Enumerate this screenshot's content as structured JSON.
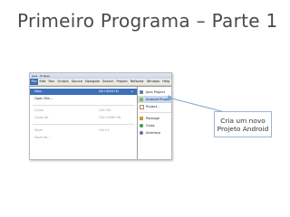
{
  "slide": {
    "title": "Primeiro Programa – Parte 1"
  },
  "window": {
    "title": "Java - Eclipse",
    "menubar": [
      "File",
      "Edit",
      "Run",
      "Scripts",
      "Source",
      "Navigate",
      "Search",
      "Project",
      "Refactor",
      "Window",
      "Help"
    ]
  },
  "file_menu": {
    "items": [
      {
        "label": "New",
        "accel": "Alt+Shift+N",
        "arrow": "▸",
        "highlighted": true
      },
      {
        "label": "Open File...",
        "accel": ""
      },
      {
        "label": "Close",
        "accel": "Ctrl+W",
        "disabled": true
      },
      {
        "label": "Close All",
        "accel": "Ctrl+Shift+W",
        "disabled": true
      },
      {
        "label": "Save",
        "accel": "Ctrl+S",
        "disabled": true
      },
      {
        "label": "Save As...",
        "accel": "",
        "disabled": true
      }
    ]
  },
  "submenu": {
    "items": [
      {
        "label": "Java Project",
        "icon": "java-project-icon",
        "color": "#5b7fb5"
      },
      {
        "label": "Android Project",
        "icon": "android-project-icon",
        "color": "#8ab833",
        "highlighted": true
      },
      {
        "label": "Project...",
        "icon": "project-icon",
        "color": "#b58b4a"
      },
      {
        "label": "Package",
        "icon": "package-icon",
        "color": "#c79a3a"
      },
      {
        "label": "Class",
        "icon": "class-icon",
        "color": "#3f9a4a"
      },
      {
        "label": "Interface",
        "icon": "interface-icon",
        "color": "#7a5fb0"
      }
    ]
  },
  "callout": {
    "line1": "Cria um novo",
    "line2": "Projeto Android"
  }
}
